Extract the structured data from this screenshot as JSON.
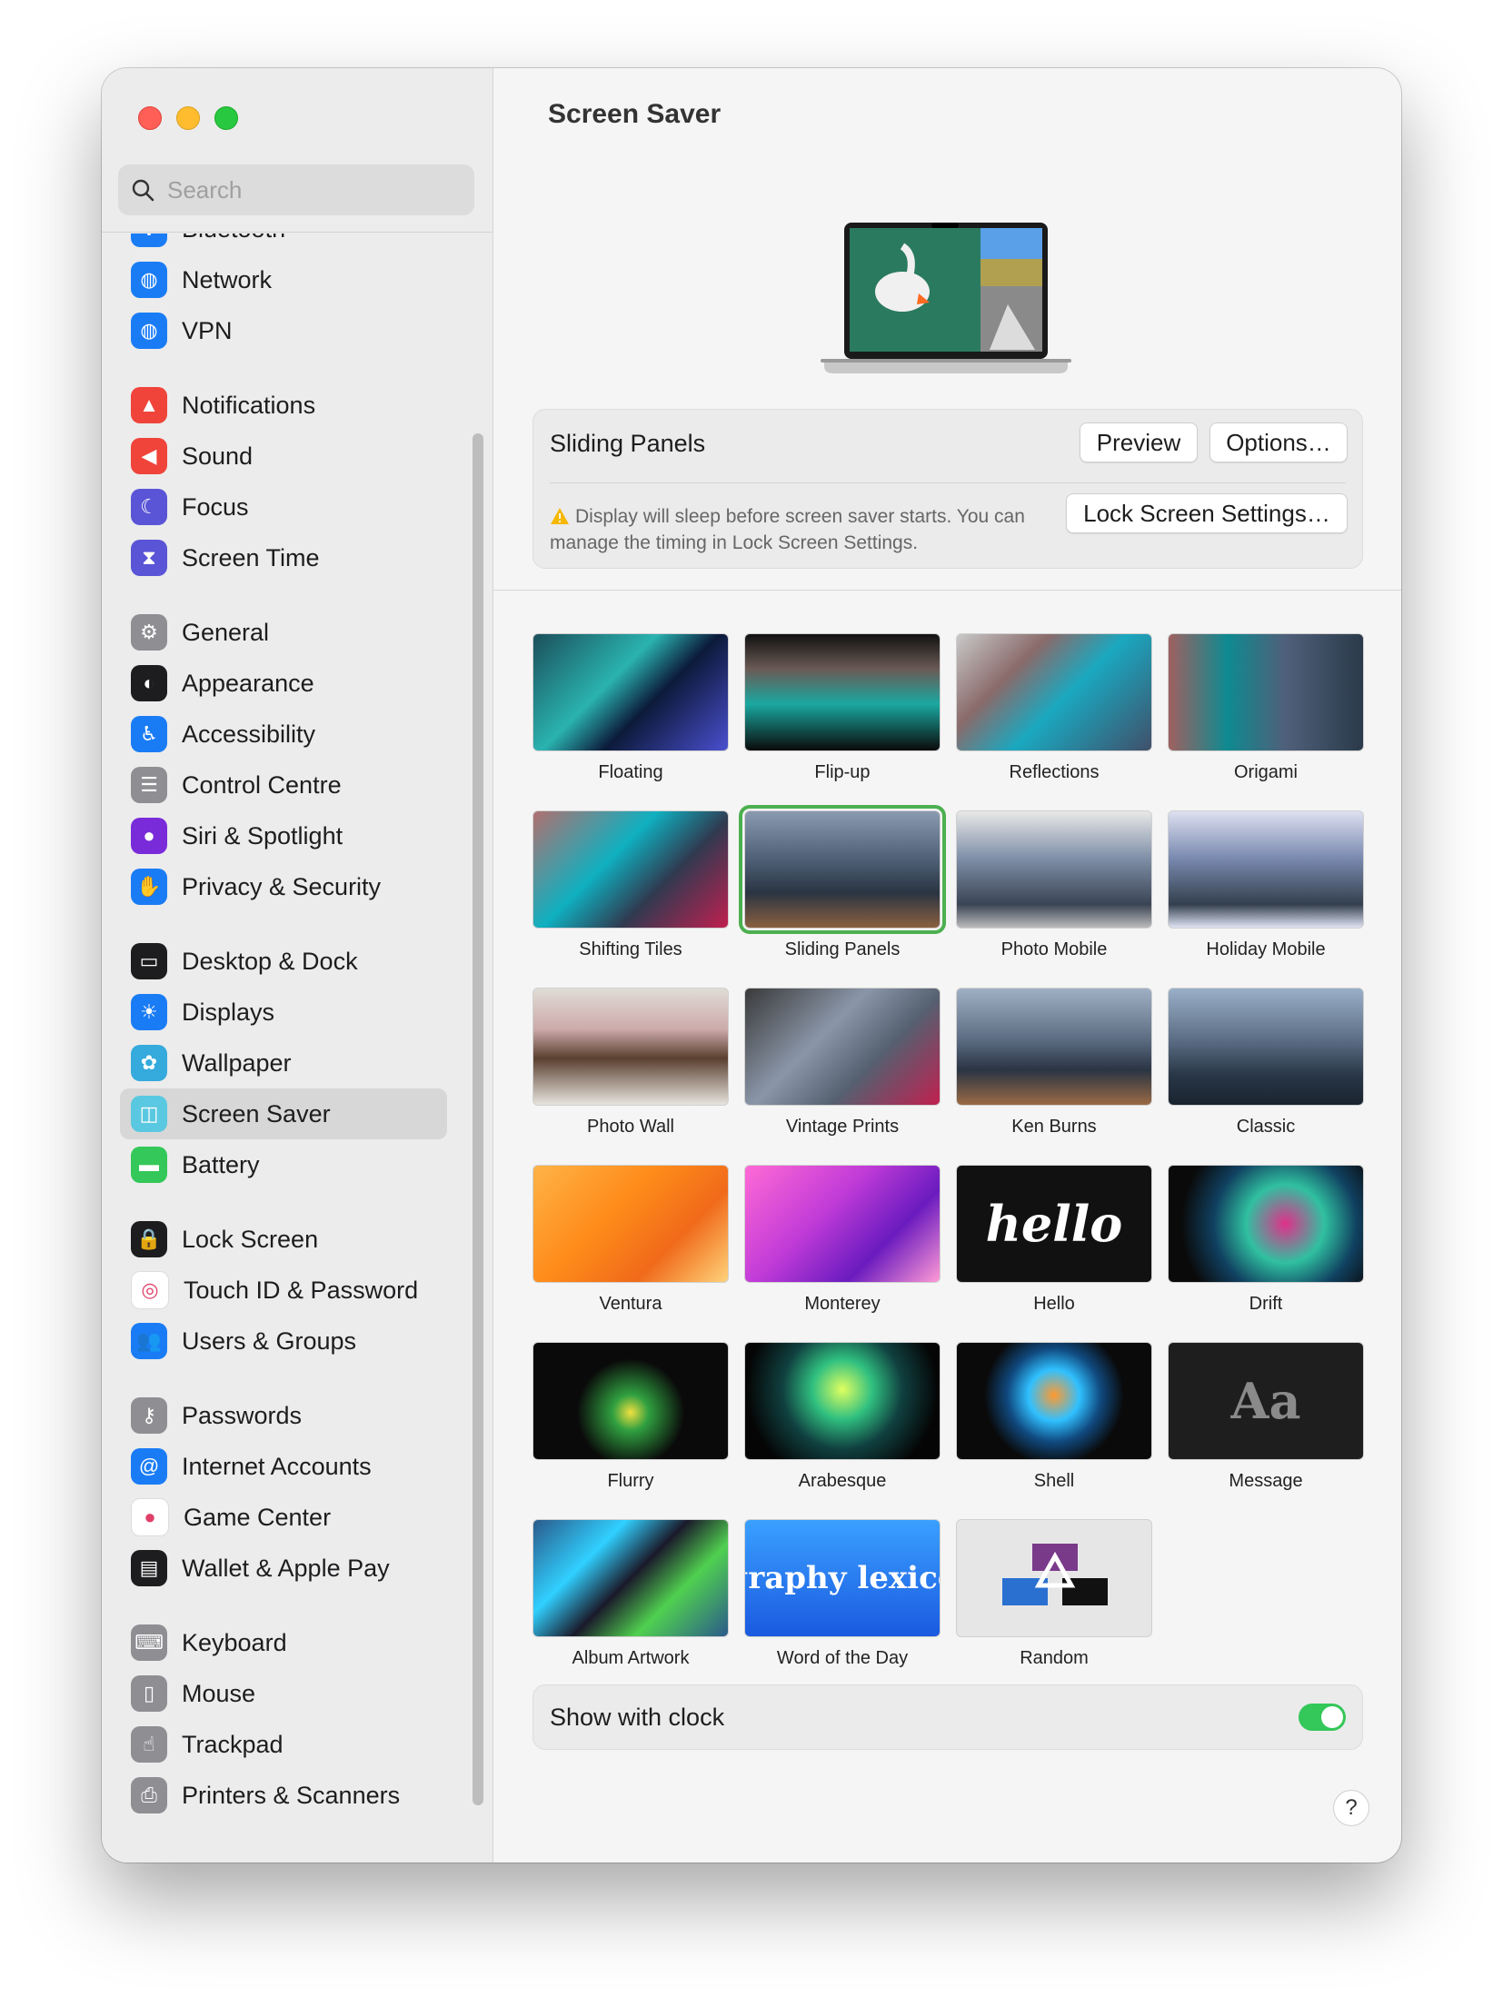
{
  "search": {
    "placeholder": "Search"
  },
  "sidebar": {
    "groups": [
      [
        {
          "label": "Bluetooth",
          "icon": "bluetooth-icon",
          "color": "#1a7cf5",
          "glyph": "✱"
        },
        {
          "label": "Network",
          "icon": "globe-icon",
          "color": "#1a7cf5",
          "glyph": "◍"
        },
        {
          "label": "VPN",
          "icon": "vpn-globe-icon",
          "color": "#1a7cf5",
          "glyph": "◍"
        }
      ],
      [
        {
          "label": "Notifications",
          "icon": "bell-icon",
          "color": "#f0443a",
          "glyph": "▲"
        },
        {
          "label": "Sound",
          "icon": "speaker-icon",
          "color": "#f0443a",
          "glyph": "◀"
        },
        {
          "label": "Focus",
          "icon": "moon-icon",
          "color": "#5a55d6",
          "glyph": "☾"
        },
        {
          "label": "Screen Time",
          "icon": "hourglass-icon",
          "color": "#5a55d6",
          "glyph": "⧗"
        }
      ],
      [
        {
          "label": "General",
          "icon": "gear-icon",
          "color": "#8e8e93",
          "glyph": "⚙"
        },
        {
          "label": "Appearance",
          "icon": "appearance-icon",
          "color": "#1d1d1f",
          "glyph": "◐"
        },
        {
          "label": "Accessibility",
          "icon": "accessibility-icon",
          "color": "#1a7cf5",
          "glyph": "♿"
        },
        {
          "label": "Control Centre",
          "icon": "toggles-icon",
          "color": "#8e8e93",
          "glyph": "☰"
        },
        {
          "label": "Siri & Spotlight",
          "icon": "siri-icon",
          "color": "#7a2bd9",
          "glyph": "●"
        },
        {
          "label": "Privacy & Security",
          "icon": "hand-icon",
          "color": "#1a7cf5",
          "glyph": "✋"
        }
      ],
      [
        {
          "label": "Desktop & Dock",
          "icon": "dock-icon",
          "color": "#1d1d1f",
          "glyph": "▭"
        },
        {
          "label": "Displays",
          "icon": "sun-icon",
          "color": "#1a7cf5",
          "glyph": "☀"
        },
        {
          "label": "Wallpaper",
          "icon": "flower-icon",
          "color": "#35aadc",
          "glyph": "✿"
        },
        {
          "label": "Screen Saver",
          "icon": "screensaver-icon",
          "color": "#5ac8e0",
          "glyph": "◫",
          "active": true
        },
        {
          "label": "Battery",
          "icon": "battery-icon",
          "color": "#34c759",
          "glyph": "▬"
        }
      ],
      [
        {
          "label": "Lock Screen",
          "icon": "lock-icon",
          "color": "#1d1d1f",
          "glyph": "🔒"
        },
        {
          "label": "Touch ID & Password",
          "icon": "fingerprint-icon",
          "color": "#ffffff",
          "glyph": "◎",
          "dark": true
        },
        {
          "label": "Users & Groups",
          "icon": "users-icon",
          "color": "#1a7cf5",
          "glyph": "👥"
        }
      ],
      [
        {
          "label": "Passwords",
          "icon": "key-icon",
          "color": "#8e8e93",
          "glyph": "⚷"
        },
        {
          "label": "Internet Accounts",
          "icon": "at-icon",
          "color": "#1a7cf5",
          "glyph": "@"
        },
        {
          "label": "Game Center",
          "icon": "gamecenter-icon",
          "color": "#ffffff",
          "glyph": "●",
          "dark": true
        },
        {
          "label": "Wallet & Apple Pay",
          "icon": "wallet-icon",
          "color": "#1d1d1f",
          "glyph": "▤"
        }
      ],
      [
        {
          "label": "Keyboard",
          "icon": "keyboard-icon",
          "color": "#8e8e93",
          "glyph": "⌨"
        },
        {
          "label": "Mouse",
          "icon": "mouse-icon",
          "color": "#8e8e93",
          "glyph": "▯"
        },
        {
          "label": "Trackpad",
          "icon": "trackpad-icon",
          "color": "#8e8e93",
          "glyph": "☝"
        },
        {
          "label": "Printers & Scanners",
          "icon": "printer-icon",
          "color": "#8e8e93",
          "glyph": "⎙"
        }
      ]
    ]
  },
  "main": {
    "title": "Screen Saver",
    "current": {
      "name": "Sliding Panels",
      "preview_label": "Preview",
      "options_label": "Options…",
      "warning": "Display will sleep before screen saver starts. You can manage the timing in Lock Screen Settings.",
      "lock_settings_label": "Lock Screen Settings…"
    },
    "savers": [
      {
        "label": "Floating",
        "bg": "linear-gradient(135deg,#1b4f5a,#2ab3b0 40%,#0c1a3a 60%,#4a4fcf)"
      },
      {
        "label": "Flip-up",
        "bg": "linear-gradient(180deg,#111 0%,#6b5a55 30%,#1aa8a0 60%,#0a0a0a)"
      },
      {
        "label": "Reflections",
        "bg": "linear-gradient(135deg,#c9c9c9,#8a6a6a 30%,#1aa8c0 55%,#40506a)"
      },
      {
        "label": "Origami",
        "bg": "linear-gradient(90deg,#a06060 0%,#0e8a90 30%,#50607a 60%,#2a3a4a)"
      },
      {
        "label": "Shifting Tiles",
        "bg": "linear-gradient(135deg,#b07070,#0fb0c0 40%,#303a50 65%,#c02050)"
      },
      {
        "label": "Sliding Panels",
        "bg": "linear-gradient(180deg,#8a9ab0 0%,#4a5a70 45%,#2a3442 70%,#8a6040)",
        "selected": true
      },
      {
        "label": "Photo Mobile",
        "bg": "linear-gradient(180deg,#e8e8e8 0%,#8090a8 40%,#3a4454 80%,#bbb)"
      },
      {
        "label": "Holiday Mobile",
        "bg": "linear-gradient(180deg,#dde0f0 0%,#7a8ab0 40%,#34404e 80%,#e0e4f4)"
      },
      {
        "label": "Photo Wall",
        "bg": "linear-gradient(180deg,#e0dcd6 0%,#caa 35%,#5a4030 60%,#e8e4de)"
      },
      {
        "label": "Vintage Prints",
        "bg": "linear-gradient(135deg,#3a3a3a,#8a96a8 40%,#556070 65%,#c02050)"
      },
      {
        "label": "Ken Burns",
        "bg": "linear-gradient(180deg,#a0b0c4 0%,#5a6a80 45%,#2a3444 70%,#9a6a44)"
      },
      {
        "label": "Classic",
        "bg": "linear-gradient(180deg,#9ab0c8 0%,#5a6c84 45%,#283646 75%,#1a2430)"
      },
      {
        "label": "Ventura",
        "bg": "linear-gradient(135deg,#ffb347,#ff8c1a 40%,#f06a1a 70%,#ffd27a)"
      },
      {
        "label": "Monterey",
        "bg": "linear-gradient(135deg,#ff6ad5,#c13bd8 40%,#6a1bbf 70%,#ff9ad5)"
      },
      {
        "label": "Hello",
        "bg": "#111111",
        "text": "hello"
      },
      {
        "label": "Drift",
        "bg": "radial-gradient(circle at 60% 50%,#e0308a 0%,#30c0a0 30%,#104060 55%,#0a0a0a 80%)"
      },
      {
        "label": "Flurry",
        "bg": "radial-gradient(circle at 50% 60%,#f0e040 0%,#30a040 15%,#0a0a0a 45%)"
      },
      {
        "label": "Arabesque",
        "bg": "radial-gradient(circle at 50% 40%,#e0ff60 0%,#30c080 25%,#104040 50%,#050505 80%)"
      },
      {
        "label": "Shell",
        "bg": "radial-gradient(circle at 50% 45%,#ff9a30 0%,#30c0ff 22%,#104a80 40%,#0a0a0a 60%)"
      },
      {
        "label": "Message",
        "bg": "#1e1e1e",
        "text": "Aa"
      },
      {
        "label": "Album Artwork",
        "bg": "linear-gradient(135deg,#2a5a8a,#30d0ff 30%,#1a1a2a 50%,#50d050 70%,#2a5a8a)"
      },
      {
        "label": "Word of the Day",
        "bg": "linear-gradient(180deg,#3aa0ff,#1a5ae0)",
        "text": "graphy lexico"
      },
      {
        "label": "Random",
        "bg": "#e6e6e6"
      }
    ],
    "clock_label": "Show with clock",
    "help_label": "?"
  }
}
